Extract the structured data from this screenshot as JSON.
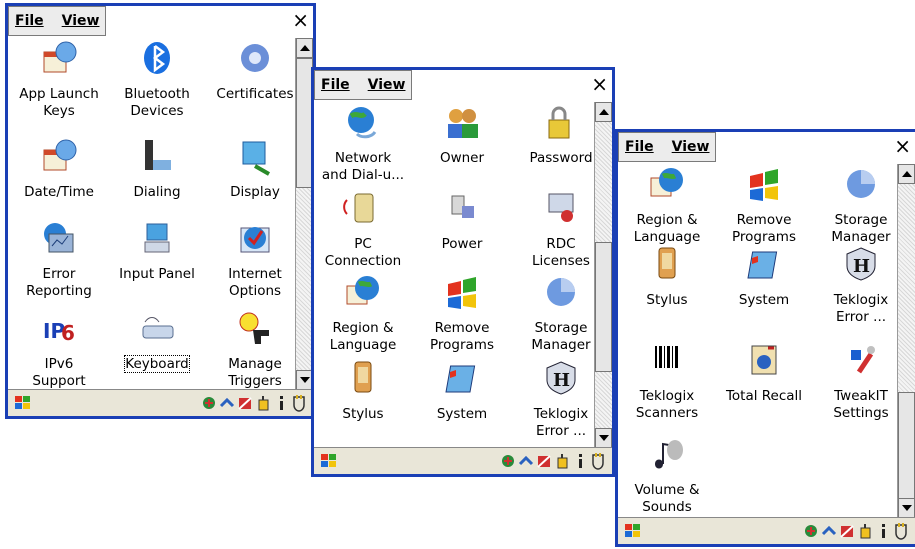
{
  "windows": [
    {
      "menus": [
        "File",
        "View"
      ],
      "close_label": "×",
      "items": [
        {
          "line1": "App Launch",
          "line2": "Keys",
          "icon": "app-launch-keys-icon"
        },
        {
          "line1": "Bluetooth",
          "line2": "Devices",
          "icon": "bluetooth-icon"
        },
        {
          "line1": "Certificates",
          "line2": "",
          "icon": "certificates-icon"
        },
        {
          "line1": "Date/Time",
          "line2": "",
          "icon": "date-time-icon"
        },
        {
          "line1": "Dialing",
          "line2": "",
          "icon": "dialing-icon"
        },
        {
          "line1": "Display",
          "line2": "",
          "icon": "display-icon"
        },
        {
          "line1": "Error",
          "line2": "Reporting",
          "icon": "error-reporting-icon"
        },
        {
          "line1": "Input Panel",
          "line2": "",
          "icon": "input-panel-icon"
        },
        {
          "line1": "Internet",
          "line2": "Options",
          "icon": "internet-options-icon"
        },
        {
          "line1": "IPv6",
          "line2": "Support",
          "icon": "ipv6-icon"
        },
        {
          "line1": "Keyboard",
          "line2": "",
          "icon": "keyboard-icon",
          "selected": true
        },
        {
          "line1": "Manage",
          "line2": "Triggers",
          "icon": "manage-triggers-icon"
        }
      ]
    },
    {
      "menus": [
        "File",
        "View"
      ],
      "close_label": "×",
      "items": [
        {
          "line1": "Network",
          "line2": "and Dial-u...",
          "icon": "network-icon"
        },
        {
          "line1": "Owner",
          "line2": "",
          "icon": "owner-icon"
        },
        {
          "line1": "Password",
          "line2": "",
          "icon": "password-icon"
        },
        {
          "line1": "PC",
          "line2": "Connection",
          "icon": "pc-connection-icon"
        },
        {
          "line1": "Power",
          "line2": "",
          "icon": "power-icon"
        },
        {
          "line1": "RDC",
          "line2": "Licenses",
          "icon": "rdc-licenses-icon"
        },
        {
          "line1": "Region &",
          "line2": "Language",
          "icon": "region-language-icon"
        },
        {
          "line1": "Remove",
          "line2": "Programs",
          "icon": "remove-programs-icon"
        },
        {
          "line1": "Storage",
          "line2": "Manager",
          "icon": "storage-manager-icon"
        },
        {
          "line1": "Stylus",
          "line2": "",
          "icon": "stylus-icon"
        },
        {
          "line1": "System",
          "line2": "",
          "icon": "system-icon"
        },
        {
          "line1": "Teklogix",
          "line2": "Error ...",
          "icon": "teklogix-error-icon"
        }
      ]
    },
    {
      "menus": [
        "File",
        "View"
      ],
      "close_label": "×",
      "items": [
        {
          "line1": "Region &",
          "line2": "Language",
          "icon": "region-language-icon"
        },
        {
          "line1": "Remove",
          "line2": "Programs",
          "icon": "remove-programs-icon"
        },
        {
          "line1": "Storage",
          "line2": "Manager",
          "icon": "storage-manager-icon"
        },
        {
          "line1": "Stylus",
          "line2": "",
          "icon": "stylus-icon"
        },
        {
          "line1": "System",
          "line2": "",
          "icon": "system-icon"
        },
        {
          "line1": "Teklogix",
          "line2": "Error ...",
          "icon": "teklogix-error-icon"
        },
        {
          "line1": "Teklogix",
          "line2": "Scanners",
          "icon": "barcode-icon"
        },
        {
          "line1": "Total Recall",
          "line2": "",
          "icon": "total-recall-icon"
        },
        {
          "line1": "TweakIT",
          "line2": "Settings",
          "icon": "tweakit-icon"
        },
        {
          "line1": "Volume &",
          "line2": "Sounds",
          "icon": "volume-icon"
        }
      ]
    }
  ],
  "tray_icons": [
    "network-tray-icon",
    "connection-tray-icon",
    "battery-tray-icon",
    "input-tray-icon",
    "info-tray-icon",
    "power-tray-icon"
  ],
  "colors": {
    "window_border": "#1a3fb5",
    "taskbar": "#e9e6d8"
  }
}
